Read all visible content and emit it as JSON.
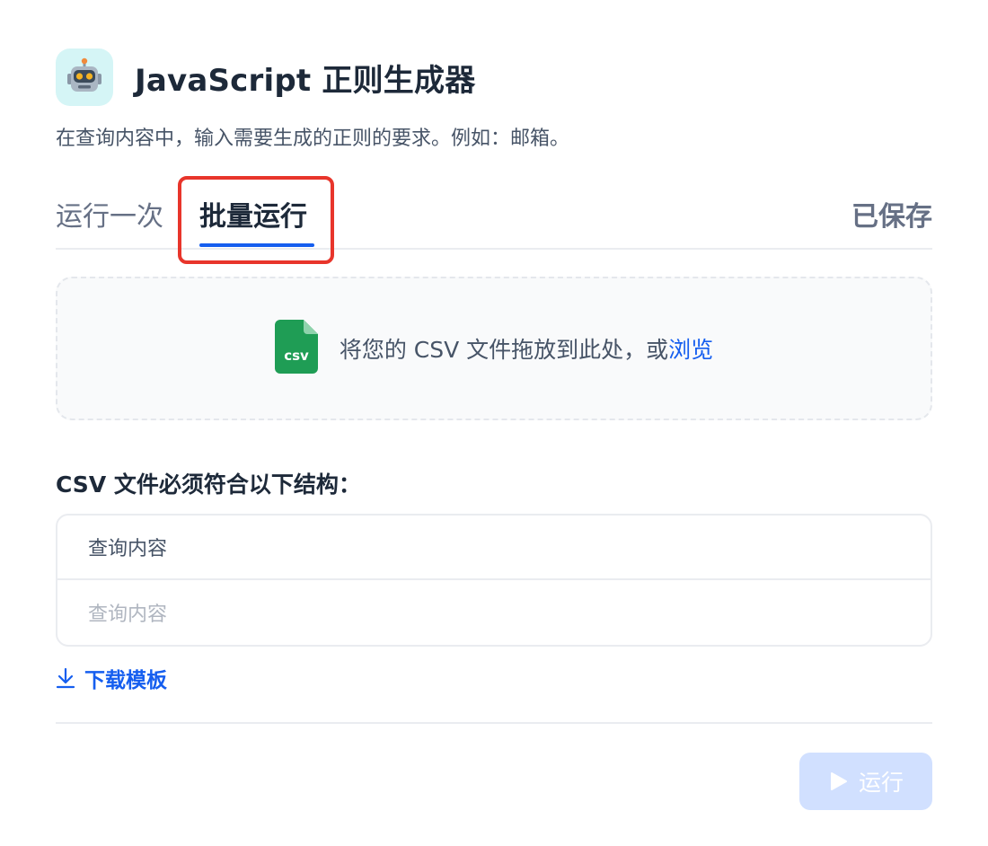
{
  "app": {
    "title": "JavaScript 正则生成器",
    "icon": "robot-icon",
    "icon_bg": "#d5f5f6",
    "description": "在查询内容中，输入需要生成的正则的要求。例如：邮箱。"
  },
  "tabs": [
    {
      "label": "运行一次",
      "active": false
    },
    {
      "label": "批量运行",
      "active": true
    }
  ],
  "saved_tab_label": "已保存",
  "highlight_color": "#e8352b",
  "dropzone": {
    "icon": "csv-file-icon",
    "icon_text": "csv",
    "text": "将您的 CSV 文件拖放到此处，或",
    "browse_label": "浏览"
  },
  "structure": {
    "label": "CSV 文件必须符合以下结构：",
    "header": "查询内容",
    "sample": "查询内容"
  },
  "download": {
    "icon": "download-icon",
    "label": "下载模板"
  },
  "run_button": {
    "icon": "play-icon",
    "label": "运行",
    "disabled": true
  },
  "colors": {
    "accent": "#155eef",
    "csv_green": "#1f9d55",
    "run_disabled_bg": "#d1e0ff"
  }
}
